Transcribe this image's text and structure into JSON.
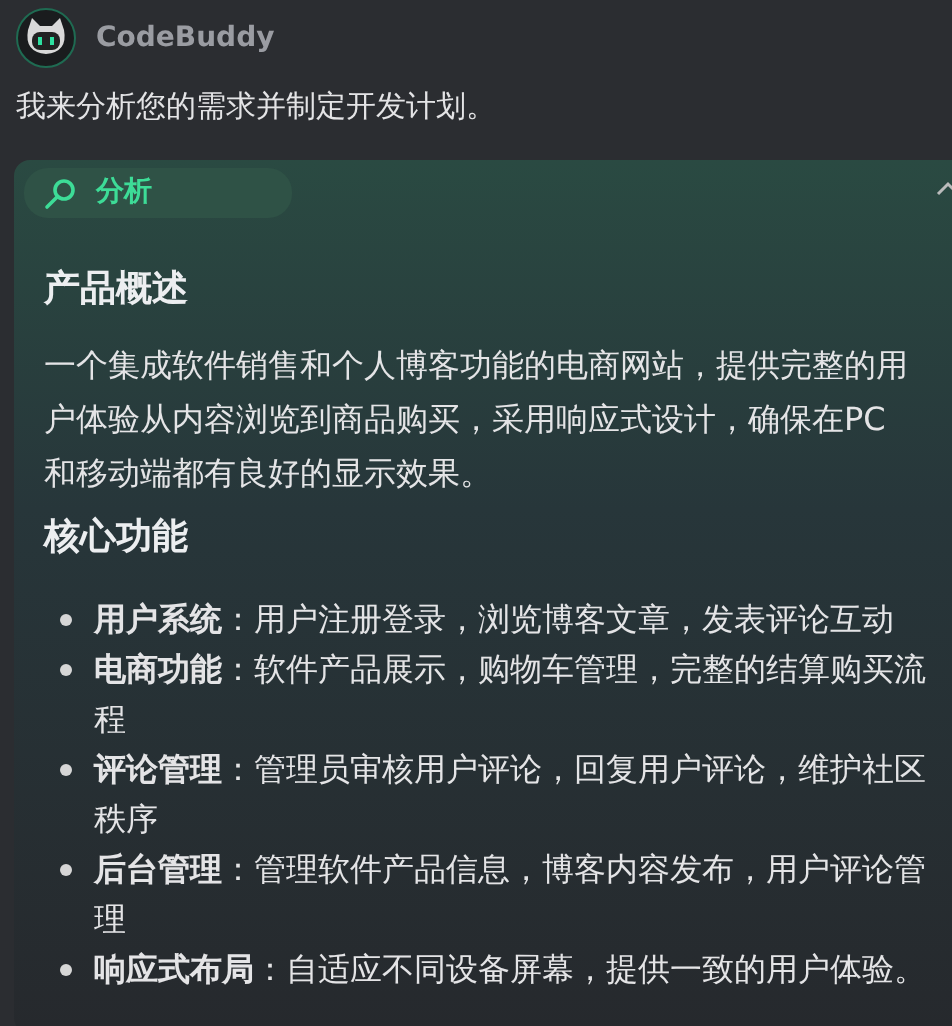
{
  "assistant": {
    "name": "CodeBuddy"
  },
  "intro": "我来分析您的需求并制定开发计划。",
  "section": {
    "label": "分析",
    "expanded": true,
    "blocks": [
      {
        "kind": "heading",
        "text": "产品概述"
      },
      {
        "kind": "paragraph",
        "text": "一个集成软件销售和个人博客功能的电商网站，提供完整的用户体验从内容浏览到商品购买，采用响应式设计，确保在PC和移动端都有良好的显示效果。"
      },
      {
        "kind": "heading",
        "text": "核心功能"
      },
      {
        "kind": "list",
        "items": [
          "**用户系统**：用户注册登录，浏览博客文章，发表评论互动",
          "**电商功能**：软件产品展示，购物车管理，完整的结算购买流程",
          "**评论管理**：管理员审核用户评论，回复用户评论，维护社区秩序",
          "**后台管理**：管理软件产品信息，博客内容发布，用户评论管理",
          "**响应式布局**：自适应不同设备屏幕，提供一致的用户体验。"
        ]
      }
    ]
  }
}
